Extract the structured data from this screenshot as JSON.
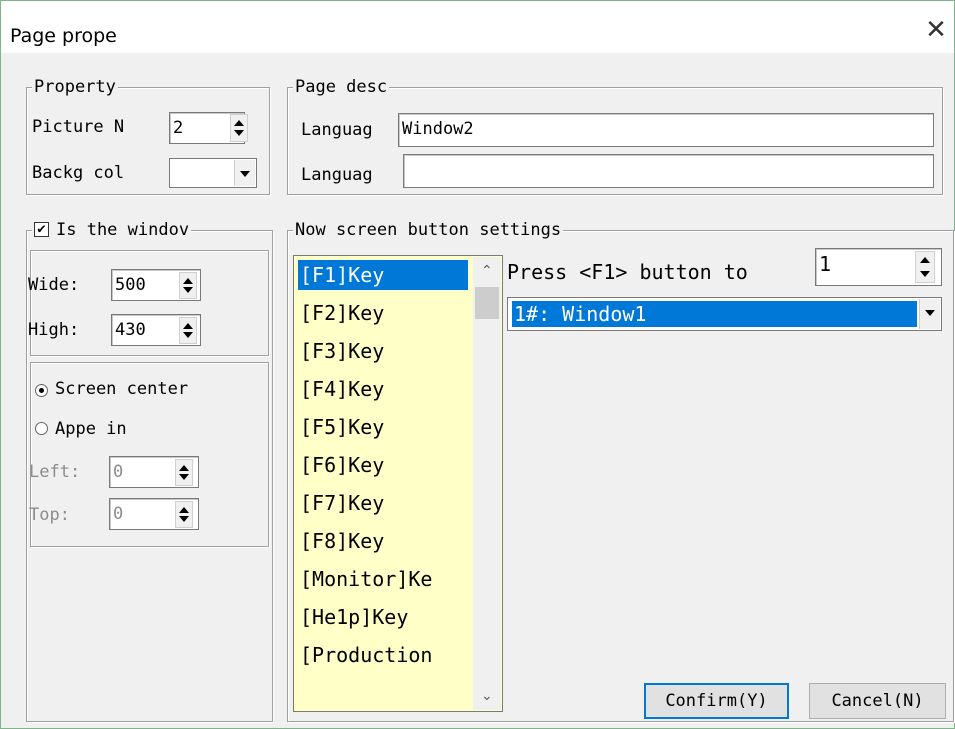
{
  "window": {
    "title": "Page prope",
    "close_symbol": "✕"
  },
  "property": {
    "label": "Property",
    "picture_no_label": "Picture N",
    "picture_no_value": "2",
    "backg_color_label": "Backg col"
  },
  "page_desc": {
    "label": "Page desc",
    "lang1_label": "Languag",
    "lang1_value": "Window2",
    "lang2_label": "Languag",
    "lang2_value": ""
  },
  "window_group": {
    "checkbox_label": "Is the windov",
    "checked": true,
    "wide_label": "Wide:",
    "wide_value": "500",
    "high_label": "High:",
    "high_value": "430",
    "screen_center_label": "Screen center",
    "appe_in_label": "Appe in",
    "left_label": "Left:",
    "left_value": "0",
    "top_label": "Top:",
    "top_value": "0",
    "selected_position": "Screen center"
  },
  "button_settings": {
    "label": "Now screen button settings",
    "keys": [
      "[F1]Key",
      "[F2]Key",
      "[F3]Key",
      "[F4]Key",
      "[F5]Key",
      "[F6]Key",
      "[F7]Key",
      "[F8]Key",
      "[Monitor]Ke",
      "[He1p]Key",
      "[Production"
    ],
    "selected_key": "[F1]Key",
    "press_label": "Press <F1> button to",
    "press_value": "1",
    "target_value": "1#: Window1"
  },
  "buttons": {
    "confirm": "Confirm(Y)",
    "cancel": "Cancel(N)"
  },
  "colors": {
    "selection": "#0078d7",
    "list_bg": "#ffffc8",
    "dialog_bg": "#f0f0f0"
  }
}
